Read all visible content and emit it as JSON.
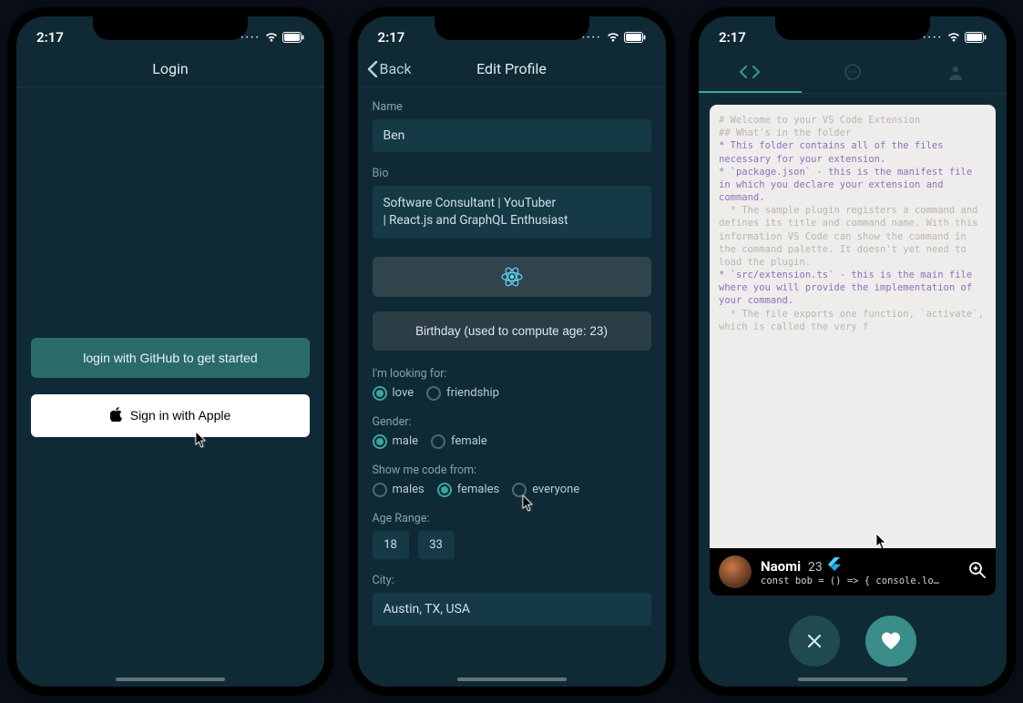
{
  "status": {
    "time": "2:17"
  },
  "phone1": {
    "title": "Login",
    "github_label": "login with GitHub to get started",
    "apple_label": "Sign in with Apple"
  },
  "phone2": {
    "back_label": "Back",
    "title": "Edit Profile",
    "name_label": "Name",
    "name_value": "Ben",
    "bio_label": "Bio",
    "bio_value": "Software Consultant | YouTuber\n| React.js and GraphQL Enthusiast",
    "birthday_label": "Birthday (used to compute age: 23)",
    "looking_label": "I'm looking for:",
    "looking_options": [
      {
        "label": "love",
        "selected": true
      },
      {
        "label": "friendship",
        "selected": false
      }
    ],
    "gender_label": "Gender:",
    "gender_options": [
      {
        "label": "male",
        "selected": true
      },
      {
        "label": "female",
        "selected": false
      }
    ],
    "show_label": "Show me code from:",
    "show_options": [
      {
        "label": "males",
        "selected": false
      },
      {
        "label": "females",
        "selected": true
      },
      {
        "label": "everyone",
        "selected": false
      }
    ],
    "age_label": "Age Range:",
    "age_min": "18",
    "age_max": "33",
    "city_label": "City:",
    "city_value": "Austin, TX, USA"
  },
  "phone3": {
    "code_lines": [
      {
        "cls": "dim",
        "text": "# Welcome to your VS Code Extension"
      },
      {
        "cls": "",
        "text": ""
      },
      {
        "cls": "dim",
        "text": "## What's in the folder"
      },
      {
        "cls": "",
        "text": ""
      },
      {
        "cls": "bullet",
        "text": "* This folder contains all of the files necessary for your extension."
      },
      {
        "cls": "bullet",
        "text": "* `package.json` - this is the manifest file in which you declare your extension and command."
      },
      {
        "cls": "dim",
        "text": "  * The sample plugin registers a command and defines its title and command name. With this information VS Code can show the command in the command palette. It doesn't yet need to load the plugin."
      },
      {
        "cls": "bullet",
        "text": "* `src/extension.ts` - this is the main file where you will provide the implementation of your command."
      },
      {
        "cls": "dim",
        "text": "  * The file exports one function, `activate`, which is called the very f"
      }
    ],
    "profile": {
      "name": "Naomi",
      "age": "23",
      "snippet": "const bob = () => { console.log(\"here..."
    }
  }
}
